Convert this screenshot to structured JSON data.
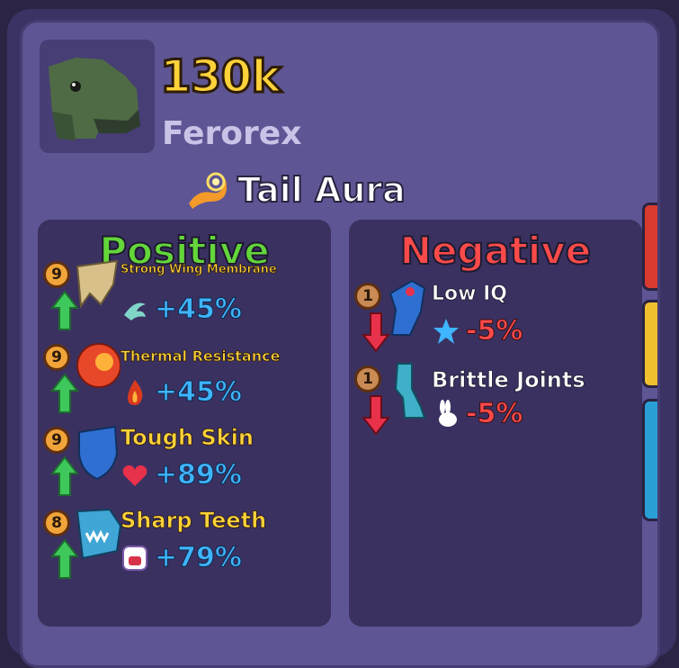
{
  "header": {
    "price": "130k",
    "name": "Ferorex",
    "aura": "Tail Aura"
  },
  "positive": {
    "title": "Positive",
    "traits": [
      {
        "level": "9",
        "name": "Strong Wing Membrane",
        "value": "+45%"
      },
      {
        "level": "9",
        "name": "Thermal Resistance",
        "value": "+45%"
      },
      {
        "level": "9",
        "name": "Tough Skin",
        "value": "+89%"
      },
      {
        "level": "8",
        "name": "Sharp Teeth",
        "value": "+79%"
      }
    ]
  },
  "negative": {
    "title": "Negative",
    "traits": [
      {
        "level": "1",
        "name": "Low IQ",
        "value": "-5%"
      },
      {
        "level": "1",
        "name": "Brittle Joints",
        "value": "-5%"
      }
    ]
  },
  "colors": {
    "price": "#ffd23a",
    "positive": "#63d63a",
    "negative": "#ff4a4a",
    "stat_positive": "#3fb4ff"
  }
}
